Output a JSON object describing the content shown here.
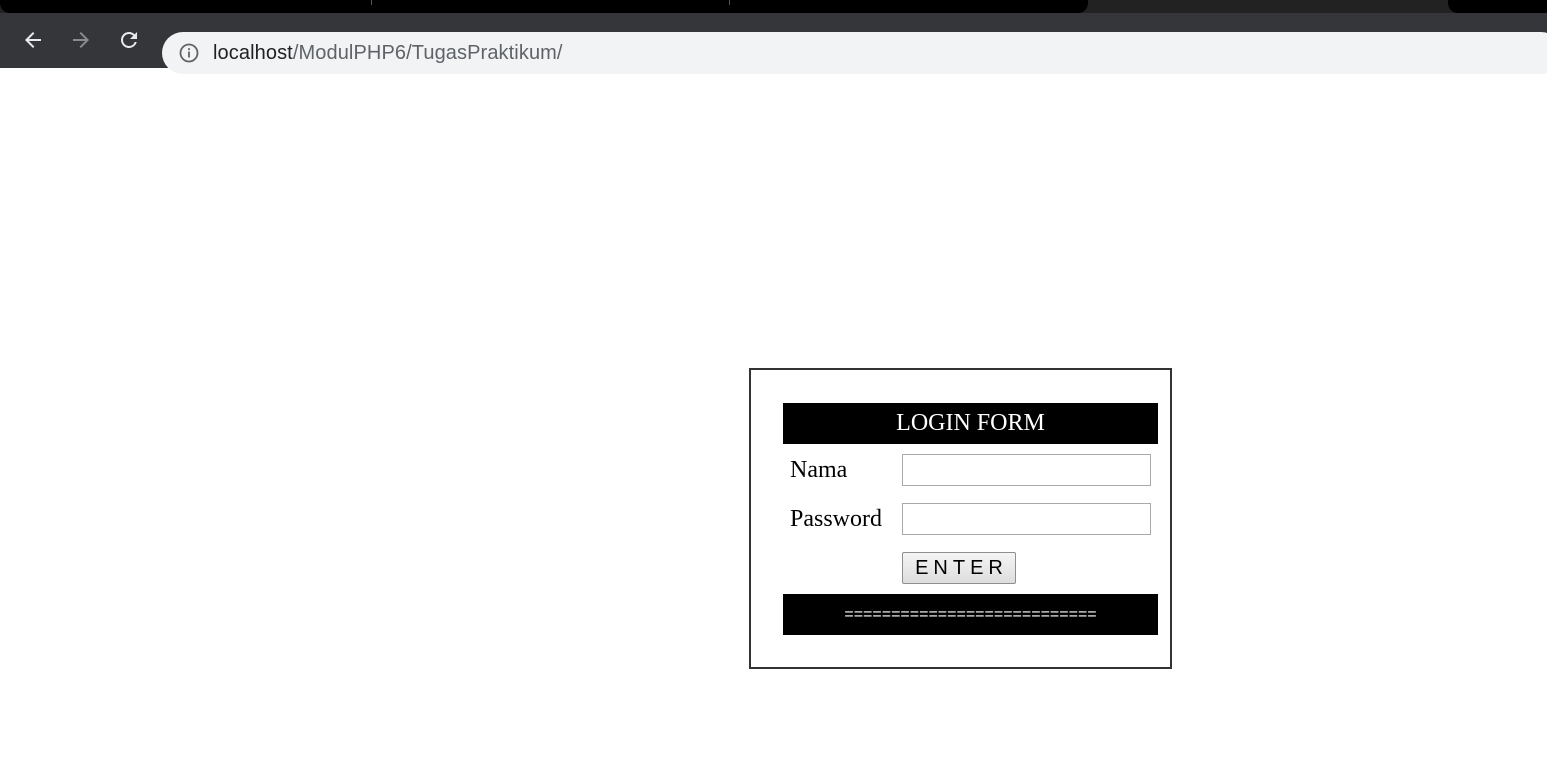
{
  "browser": {
    "url_host": "localhost",
    "url_path": "/ModulPHP6/TugasPraktikum/",
    "icons": {
      "back": "arrow-left-icon",
      "forward": "arrow-right-icon",
      "reload": "reload-icon",
      "site_info": "info-icon"
    }
  },
  "login_form": {
    "title": "LOGIN FORM",
    "fields": [
      {
        "label": "Nama",
        "value": "",
        "type": "text"
      },
      {
        "label": "Password",
        "value": "",
        "type": "password"
      }
    ],
    "submit_label": "ENTER",
    "footer_text": "==========================="
  },
  "colors": {
    "header_bg": "#000000",
    "header_text": "#ffffff",
    "toolbar_bg": "#35363a",
    "omnibox_bg": "#f1f3f4"
  }
}
